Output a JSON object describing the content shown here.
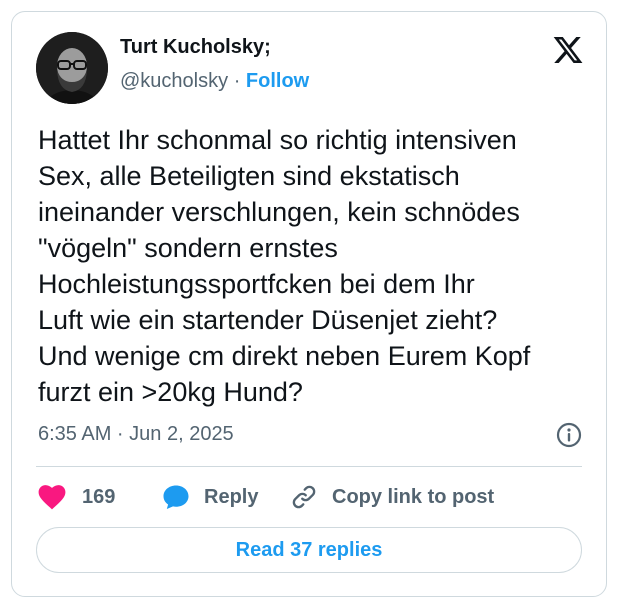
{
  "author": {
    "display_name": "Turt Kucholsky;",
    "handle": "@kucholsky",
    "separator": "·",
    "follow_label": "Follow"
  },
  "icons": {
    "brand": "x-logo-icon",
    "info": "info-icon",
    "like": "heart-icon",
    "reply": "speech-bubble-icon",
    "copy_link": "link-icon"
  },
  "tweet": {
    "text": "Hattet Ihr schonmal so richtig intensiven\nSex, alle Beteiligten sind ekstatisch\nineinander verschlungen, kein schnödes\n\"vögeln\" sondern ernstes\nHochleistungssportfcken bei dem Ihr\nLuft wie ein startender Düsenjet zieht?\nUnd wenige cm direkt neben Eurem Kopf\nfurzt ein >20kg Hund?",
    "timestamp": "6:35 AM · Jun 2, 2025"
  },
  "actions": {
    "like_count": "169",
    "reply_label": "Reply",
    "copy_label": "Copy link to post"
  },
  "read_replies_label": "Read 37 replies",
  "colors": {
    "accent": "#1d9bf0",
    "like": "#f91880",
    "text": "#0f1419",
    "muted": "#536471",
    "border": "#cfd9de"
  }
}
